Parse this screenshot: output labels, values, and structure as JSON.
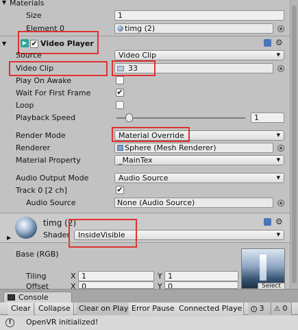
{
  "materials": {
    "header": "Materials",
    "size_label": "Size",
    "size_value": "1",
    "element_label": "Element 0",
    "element_value": "timg (2)"
  },
  "video_player": {
    "title": "Video Player",
    "rows": {
      "source_label": "Source",
      "source_value": "Video Clip",
      "video_clip_label": "Video Clip",
      "video_clip_value": "33",
      "play_on_awake_label": "Play On Awake",
      "wait_first_frame_label": "Wait For First Frame",
      "loop_label": "Loop",
      "playback_speed_label": "Playback Speed",
      "playback_speed_value": "1",
      "render_mode_label": "Render Mode",
      "render_mode_value": "Material Override",
      "renderer_label": "Renderer",
      "renderer_value": "Sphere (Mesh Renderer)",
      "material_property_label": "Material Property",
      "material_property_value": "_MainTex",
      "audio_output_label": "Audio Output Mode",
      "audio_output_value": "Audio Source",
      "track_label": "Track 0 [2 ch]",
      "audio_source_label": "Audio Source",
      "audio_source_value": "None (Audio Source)"
    },
    "checks": {
      "enabled": true,
      "play_on_awake": false,
      "wait_first_frame": true,
      "loop": false,
      "track0": true
    },
    "playback_speed_fraction": 0.06
  },
  "material": {
    "name": "timg (2)",
    "shader_label": "Shader",
    "shader_value": "InsideVisible",
    "base_label": "Base (RGB)",
    "tiling_label": "Tiling",
    "offset_label": "Offset",
    "x_label": "X",
    "y_label": "Y",
    "tiling_x": "1",
    "tiling_y": "1",
    "offset_x": "0",
    "offset_y": "0",
    "select_label": "Select"
  },
  "console": {
    "tab": "Console",
    "buttons": [
      "Clear",
      "Collapse",
      "Clear on Play",
      "Error Pause",
      "Connected Playe"
    ],
    "error_count": "3",
    "warning_count": "0",
    "message": "OpenVR initialized!"
  },
  "colors": {
    "highlight_red": "#e0312f",
    "panel_bg": "#c2c2c2",
    "component_icon": "#2aa59a"
  }
}
